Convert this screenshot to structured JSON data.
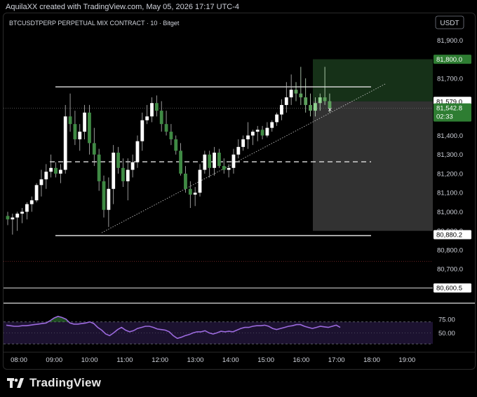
{
  "credit": "AquilaXX created with TradingView.com, May 05, 2026 17:17 UTC-4",
  "footer_brand": "TradingView",
  "chart_data": {
    "type": "candlestick",
    "title": "BTCUSDTPERP PERPETUAL MIX CONTRACT · 10 · Bitget",
    "currency": "USDT",
    "ylim": [
      80550,
      81960
    ],
    "y_ticks": [
      "81,900.0",
      "81,700.0",
      "81,400.0",
      "81,300.0",
      "81,200.0",
      "81,100.0",
      "81,000.0",
      "80,900.0",
      "80,800.0",
      "80,700.0"
    ],
    "x_ticks": [
      "08:00",
      "09:00",
      "10:00",
      "11:00",
      "12:00",
      "13:00",
      "14:00",
      "15:00",
      "16:00",
      "17:00",
      "18:00",
      "19:00"
    ],
    "price_badges": [
      {
        "label": "81,800.0",
        "value": 81800,
        "style": "green"
      },
      {
        "label": "81,579.0",
        "value": 81579,
        "style": "white"
      },
      {
        "label": "81,542.8",
        "sub": "02:33",
        "value": 81542.8,
        "style": "green"
      },
      {
        "label": "80,880.2",
        "value": 80880.2,
        "style": "white"
      },
      {
        "label": "80,600.5",
        "value": 80600.5,
        "style": "white"
      }
    ],
    "levels": {
      "range_top": 81655,
      "range_mid": 81262,
      "range_bottom": 80875,
      "dotted_current": 81542.8,
      "red_dotted": 80740,
      "white_line": 80600.5
    },
    "position": {
      "entry": 81579,
      "target": 81800,
      "stop": 80900
    },
    "candles": [
      [
        80978,
        81000,
        80930,
        80960
      ],
      [
        80960,
        80990,
        80880,
        80970
      ],
      [
        80970,
        81000,
        80900,
        80990
      ],
      [
        80990,
        81020,
        80940,
        81000
      ],
      [
        81000,
        81050,
        80960,
        81040
      ],
      [
        81040,
        81080,
        81000,
        81060
      ],
      [
        81060,
        81150,
        81050,
        81140
      ],
      [
        81140,
        81220,
        81080,
        81170
      ],
      [
        81170,
        81250,
        81120,
        81210
      ],
      [
        81210,
        81300,
        81180,
        81230
      ],
      [
        81230,
        81260,
        81180,
        81200
      ],
      [
        81200,
        81250,
        81150,
        81220
      ],
      [
        81220,
        81560,
        81200,
        81500
      ],
      [
        81500,
        81620,
        81420,
        81460
      ],
      [
        81460,
        81530,
        81350,
        81380
      ],
      [
        81380,
        81460,
        81320,
        81420
      ],
      [
        81420,
        81560,
        81380,
        81520
      ],
      [
        81520,
        81560,
        81300,
        81360
      ],
      [
        81360,
        81440,
        81240,
        81300
      ],
      [
        81300,
        81330,
        81110,
        81160
      ],
      [
        81160,
        81190,
        80970,
        81010
      ],
      [
        81010,
        81180,
        80920,
        81120
      ],
      [
        81120,
        81350,
        81040,
        81310
      ],
      [
        81310,
        81340,
        81200,
        81230
      ],
      [
        81230,
        81280,
        81130,
        81160
      ],
      [
        81160,
        81280,
        81060,
        81220
      ],
      [
        81220,
        81300,
        81180,
        81260
      ],
      [
        81260,
        81400,
        81230,
        81370
      ],
      [
        81370,
        81520,
        81320,
        81480
      ],
      [
        81480,
        81560,
        81460,
        81500
      ],
      [
        81500,
        81600,
        81470,
        81570
      ],
      [
        81570,
        81610,
        81500,
        81530
      ],
      [
        81530,
        81580,
        81420,
        81460
      ],
      [
        81460,
        81530,
        81400,
        81420
      ],
      [
        81420,
        81460,
        81350,
        81380
      ],
      [
        81380,
        81400,
        81300,
        81320
      ],
      [
        81320,
        81360,
        81190,
        81200
      ],
      [
        81200,
        81240,
        81100,
        81120
      ],
      [
        81120,
        81160,
        81020,
        81090
      ],
      [
        81090,
        81130,
        81030,
        81100
      ],
      [
        81100,
        81250,
        81080,
        81220
      ],
      [
        81220,
        81320,
        81200,
        81300
      ],
      [
        81300,
        81320,
        81180,
        81230
      ],
      [
        81230,
        81340,
        81190,
        81310
      ],
      [
        81310,
        81330,
        81230,
        81240
      ],
      [
        81240,
        81280,
        81200,
        81220
      ],
      [
        81220,
        81250,
        81180,
        81230
      ],
      [
        81230,
        81330,
        81200,
        81300
      ],
      [
        81300,
        81380,
        81280,
        81340
      ],
      [
        81340,
        81400,
        81320,
        81380
      ],
      [
        81380,
        81470,
        81330,
        81400
      ],
      [
        81400,
        81430,
        81350,
        81420
      ],
      [
        81420,
        81450,
        81370,
        81430
      ],
      [
        81430,
        81450,
        81380,
        81400
      ],
      [
        81400,
        81470,
        81390,
        81440
      ],
      [
        81440,
        81480,
        81420,
        81470
      ],
      [
        81470,
        81520,
        81450,
        81510
      ],
      [
        81510,
        81590,
        81480,
        81560
      ],
      [
        81560,
        81680,
        81520,
        81600
      ],
      [
        81600,
        81720,
        81560,
        81640
      ],
      [
        81640,
        81680,
        81580,
        81620
      ],
      [
        81620,
        81760,
        81560,
        81600
      ],
      [
        81600,
        81700,
        81520,
        81560
      ],
      [
        81560,
        81620,
        81500,
        81530
      ],
      [
        81530,
        81600,
        81500,
        81570
      ],
      [
        81570,
        81620,
        81530,
        81600
      ],
      [
        81600,
        81760,
        81560,
        81580
      ],
      [
        81580,
        81620,
        81520,
        81542.8
      ]
    ],
    "rsi": {
      "upper": 70,
      "lower": 30,
      "ylim": [
        20,
        90
      ],
      "y_ticks": [
        "75.00",
        "50.00"
      ],
      "values": [
        64,
        63,
        62,
        62,
        63,
        63,
        64,
        65,
        66,
        67,
        68,
        72,
        77,
        80,
        78,
        75,
        68,
        66,
        66,
        67,
        68,
        70,
        67,
        60,
        55,
        48,
        45,
        50,
        56,
        60,
        55,
        52,
        54,
        58,
        60,
        62,
        62,
        60,
        57,
        56,
        55,
        52,
        45,
        40,
        42,
        45,
        47,
        50,
        52,
        52,
        54,
        50,
        48,
        50,
        53,
        52,
        53,
        52,
        55,
        58,
        60,
        60,
        62,
        63,
        63,
        64,
        62,
        58,
        56,
        58,
        60,
        62,
        63,
        65,
        65,
        62,
        60,
        58,
        60,
        62,
        61,
        60,
        62,
        64,
        60
      ]
    }
  }
}
